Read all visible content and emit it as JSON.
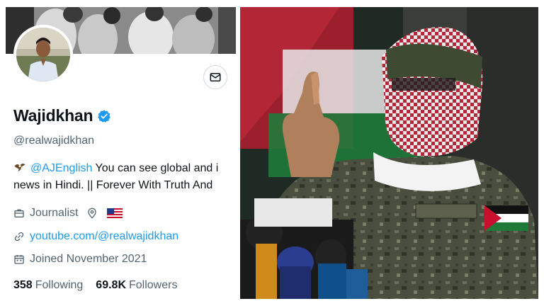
{
  "profile": {
    "display_name": "Wajidkhan",
    "handle": "@realwajidkhan",
    "bio_mention": "@AJEnglish",
    "bio_line1_rest": " You can see global and i",
    "bio_line2": "news in Hindi. || Forever With Truth And",
    "occupation": "Journalist",
    "website": "youtube.com/@realwajidkhan",
    "joined": "Joined November 2021",
    "following_count": "358",
    "following_label": "Following",
    "followers_count": "69.8K",
    "followers_label": "Followers"
  },
  "icons": {
    "message": "mail-icon",
    "verified": "verified-badge-icon",
    "occupation": "briefcase-icon",
    "location": "location-pin-icon",
    "flag": "us-flag-icon",
    "link": "link-icon",
    "calendar": "calendar-icon",
    "bio_emoji": "eagle-icon"
  },
  "colors": {
    "accent": "#1d9bf0",
    "text_primary": "#0f1419",
    "text_secondary": "#536471"
  }
}
